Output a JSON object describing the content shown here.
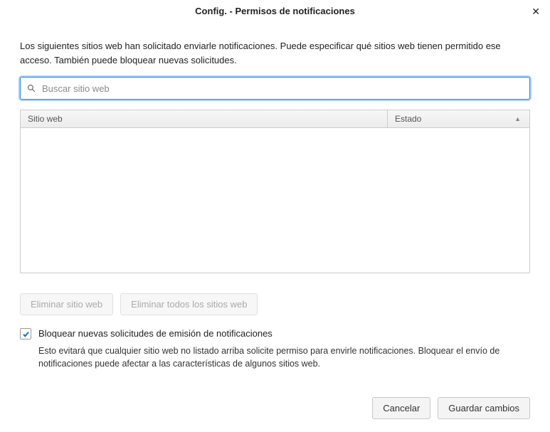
{
  "title": "Config. - Permisos de notificaciones",
  "intro_line1": "Los siguientes sitios web han solicitado enviarle notificaciones. Puede especificar qué sitios web tienen permitido ese ",
  "intro_line2": "acceso. También puede bloquear nuevas solicitudes.",
  "search": {
    "placeholder": "Buscar sitio web"
  },
  "table": {
    "col_site": "Sitio web",
    "col_status": "Estado",
    "rows": []
  },
  "buttons": {
    "remove_site": "Eliminar sitio web",
    "remove_all": "Eliminar todos los sitios web",
    "cancel": "Cancelar",
    "save": "Guardar cambios"
  },
  "block_new": {
    "checked": true,
    "label": "Bloquear nuevas solicitudes de emisión de notificaciones",
    "desc": "Esto evitará que cualquier sitio web no listado arriba solicite permiso para envirle notificaciones. Bloquear el envío de notificaciones puede afectar a las características de algunos sitios web."
  }
}
